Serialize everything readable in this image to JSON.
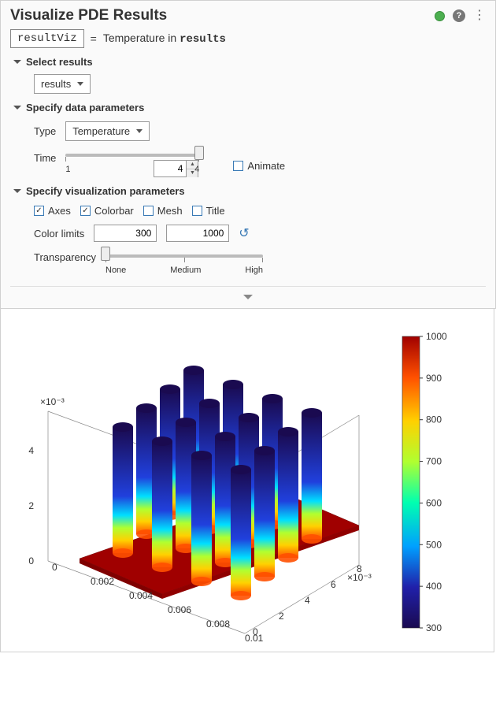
{
  "title": "Visualize PDE Results",
  "variable": "resultViz",
  "equals": "=",
  "description_prefix": "Temperature in ",
  "description_code": "results",
  "sections": {
    "select_results": {
      "label": "Select results",
      "dropdown": "results"
    },
    "data_params": {
      "label": "Specify data parameters",
      "type_label": "Type",
      "type_value": "Temperature",
      "time_label": "Time",
      "time_min": "1",
      "time_max": "4",
      "time_value": "4",
      "animate_label": "Animate",
      "animate_checked": false
    },
    "viz_params": {
      "label": "Specify visualization parameters",
      "checks": {
        "axes": {
          "label": "Axes",
          "checked": true
        },
        "colorbar": {
          "label": "Colorbar",
          "checked": true
        },
        "mesh": {
          "label": "Mesh",
          "checked": false
        },
        "title": {
          "label": "Title",
          "checked": false
        }
      },
      "color_limits_label": "Color limits",
      "color_limit_low": "300",
      "color_limit_high": "1000",
      "transparency_label": "Transparency",
      "transparency_levels": {
        "none": "None",
        "medium": "Medium",
        "high": "High"
      }
    }
  },
  "chart_data": {
    "type": "heatmap",
    "description": "3D thermal plot of cylindrical fin array on heated base plate",
    "axes": {
      "z_multiplier_label": "×10⁻³",
      "x_multiplier_label": "×10⁻³",
      "z_ticks": [
        0,
        2,
        4
      ],
      "x_ticks": [
        0,
        0.002,
        0.004,
        0.006,
        0.008,
        0.01
      ],
      "y_ticks": [
        0,
        2,
        4,
        6,
        8
      ]
    },
    "colorbar": {
      "min": 300,
      "max": 1000,
      "ticks": [
        300,
        400,
        500,
        600,
        700,
        800,
        900,
        1000
      ],
      "colormap": "jet"
    },
    "base_temperature_approx": 1000,
    "fin_tip_temperature_approx": 320,
    "fin_grid": "4x4 cylinders"
  }
}
